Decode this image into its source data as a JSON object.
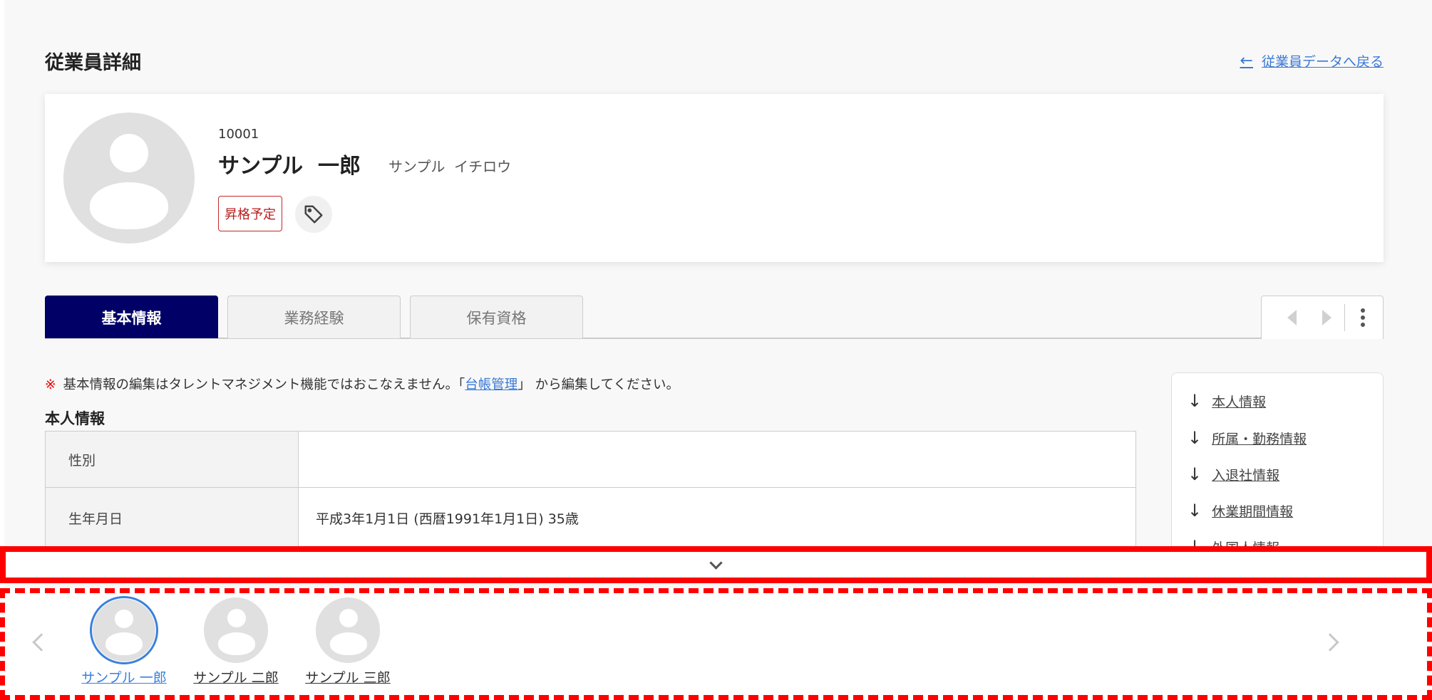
{
  "header": {
    "title": "従業員詳細",
    "back_link": "従業員データへ戻る"
  },
  "profile": {
    "employee_id": "10001",
    "name": "サンプル  一郎",
    "kana": "サンプル  イチロウ",
    "badge": "昇格予定"
  },
  "tabs": [
    {
      "label": "基本情報",
      "active": true
    },
    {
      "label": "業務経験",
      "active": false
    },
    {
      "label": "保有資格",
      "active": false
    }
  ],
  "notice": {
    "mark": "※",
    "before": "基本情報の編集はタレントマネジメント機能ではおこなえません。「",
    "link": "台帳管理",
    "after": "」 から編集してください。"
  },
  "section": {
    "title": "本人情報",
    "rows": [
      {
        "label": "性別",
        "value": ""
      },
      {
        "label": "生年月日",
        "value": "平成3年1月1日  (西暦1991年1月1日)  35歳"
      }
    ]
  },
  "side_nav": [
    "本人情報",
    "所属・勤務情報",
    "入退社情報",
    "休業期間情報",
    "外国人情報"
  ],
  "carousel": {
    "employees": [
      {
        "name": "サンプル 一郎",
        "selected": true
      },
      {
        "name": "サンプル 二郎",
        "selected": false
      },
      {
        "name": "サンプル 三郎",
        "selected": false
      }
    ]
  },
  "colors": {
    "accent": "#000066",
    "link": "#3a78d6",
    "highlight": "#ff0000",
    "badge": "#c62828"
  }
}
